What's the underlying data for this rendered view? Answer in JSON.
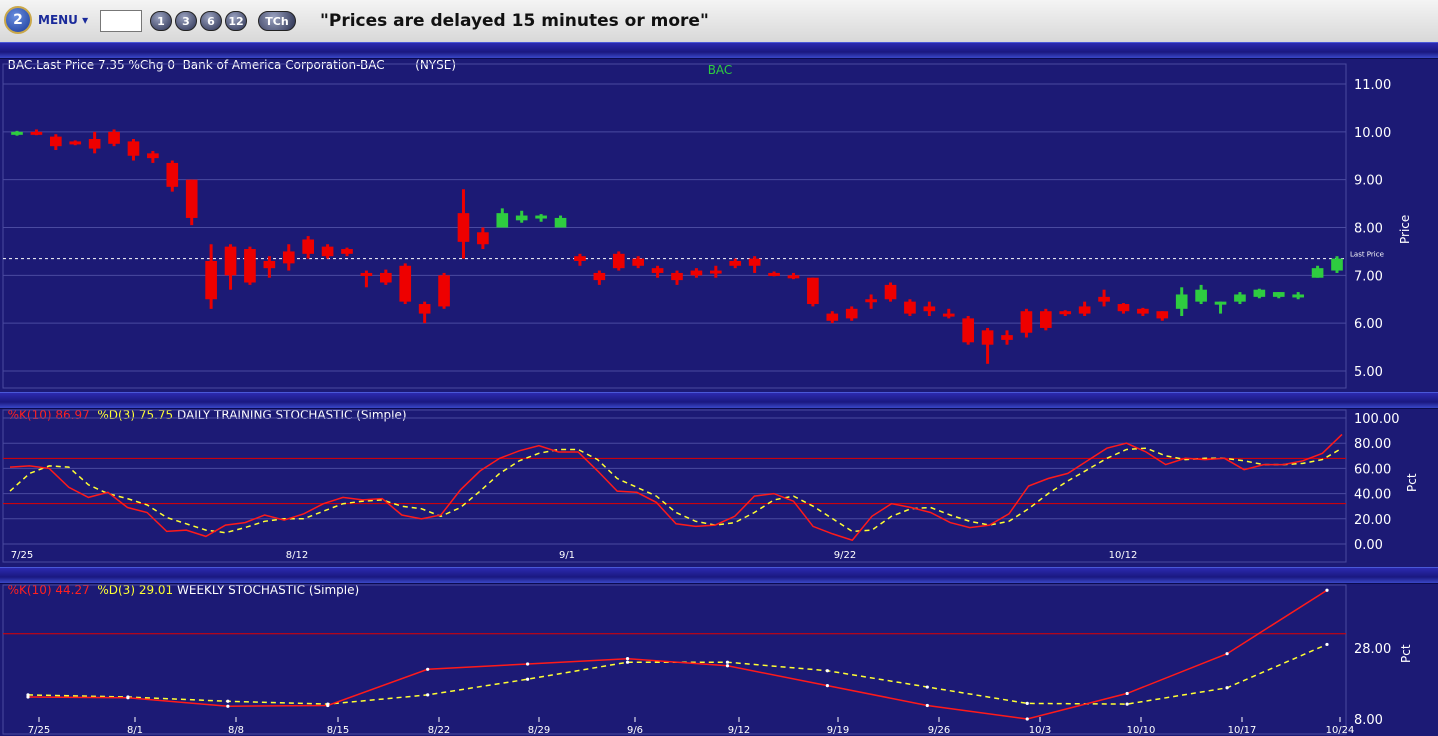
{
  "toolbar": {
    "logo": "2",
    "menu_label": "MENU ▾",
    "period_buttons": [
      "1",
      "3",
      "6",
      "12"
    ],
    "tch_label": "TCh",
    "delay_notice": "\"Prices are delayed 15 minutes or more\""
  },
  "quote_header": {
    "text": "BAC.Last Price 7.35 %Chg 0  Bank of America Corporation-BAC        (NYSE)"
  },
  "colors": {
    "background": "#1c1a75",
    "up_candle": "#2ecc40",
    "down_candle": "#ee0000",
    "k_line": "#ff1a1a",
    "d_line": "#ffff33",
    "grid": "#4a4aa0",
    "axis_text": "#ffffff"
  },
  "chart_data": [
    {
      "type": "candlestick",
      "title": "BAC",
      "ylabel": "Price",
      "ylim": [
        5.0,
        11.0
      ],
      "yticks": [
        "11.00",
        "10.00",
        "9.00",
        "8.00",
        "7.00",
        "6.00",
        "5.00"
      ],
      "last_price": 7.35,
      "last_price_label": "Last Price",
      "candles": [
        {
          "o": 9.95,
          "h": 10.02,
          "l": 9.92,
          "c": 10.0
        },
        {
          "o": 10.0,
          "h": 10.05,
          "l": 9.93,
          "c": 9.97
        },
        {
          "o": 9.9,
          "h": 9.95,
          "l": 9.62,
          "c": 9.7
        },
        {
          "o": 9.8,
          "h": 9.82,
          "l": 9.72,
          "c": 9.74
        },
        {
          "o": 9.85,
          "h": 10.0,
          "l": 9.55,
          "c": 9.65
        },
        {
          "o": 10.0,
          "h": 10.05,
          "l": 9.7,
          "c": 9.75
        },
        {
          "o": 9.8,
          "h": 9.85,
          "l": 9.4,
          "c": 9.5
        },
        {
          "o": 9.55,
          "h": 9.6,
          "l": 9.35,
          "c": 9.45
        },
        {
          "o": 9.35,
          "h": 9.4,
          "l": 8.75,
          "c": 8.85
        },
        {
          "o": 9.0,
          "h": 9.0,
          "l": 8.05,
          "c": 8.2
        },
        {
          "o": 7.3,
          "h": 7.65,
          "l": 6.3,
          "c": 6.5
        },
        {
          "o": 7.6,
          "h": 7.65,
          "l": 6.7,
          "c": 7.0
        },
        {
          "o": 7.55,
          "h": 7.6,
          "l": 6.8,
          "c": 6.85
        },
        {
          "o": 7.3,
          "h": 7.4,
          "l": 6.95,
          "c": 7.15
        },
        {
          "o": 7.5,
          "h": 7.65,
          "l": 7.1,
          "c": 7.25
        },
        {
          "o": 7.75,
          "h": 7.82,
          "l": 7.35,
          "c": 7.45
        },
        {
          "o": 7.6,
          "h": 7.65,
          "l": 7.35,
          "c": 7.4
        },
        {
          "o": 7.55,
          "h": 7.58,
          "l": 7.4,
          "c": 7.45
        },
        {
          "o": 7.05,
          "h": 7.1,
          "l": 6.75,
          "c": 7.0
        },
        {
          "o": 7.05,
          "h": 7.12,
          "l": 6.8,
          "c": 6.85
        },
        {
          "o": 7.2,
          "h": 7.25,
          "l": 6.4,
          "c": 6.45
        },
        {
          "o": 6.4,
          "h": 6.45,
          "l": 6.0,
          "c": 6.2
        },
        {
          "o": 7.0,
          "h": 7.05,
          "l": 6.3,
          "c": 6.35
        },
        {
          "o": 8.3,
          "h": 8.8,
          "l": 7.35,
          "c": 7.7
        },
        {
          "o": 7.9,
          "h": 8.0,
          "l": 7.55,
          "c": 7.65
        },
        {
          "o": 8.0,
          "h": 8.4,
          "l": 8.0,
          "c": 8.3
        },
        {
          "o": 8.15,
          "h": 8.35,
          "l": 8.1,
          "c": 8.25
        },
        {
          "o": 8.2,
          "h": 8.28,
          "l": 8.12,
          "c": 8.25
        },
        {
          "o": 8.0,
          "h": 8.25,
          "l": 8.0,
          "c": 8.2
        },
        {
          "o": 7.4,
          "h": 7.45,
          "l": 7.2,
          "c": 7.3
        },
        {
          "o": 7.05,
          "h": 7.1,
          "l": 6.8,
          "c": 6.9
        },
        {
          "o": 7.45,
          "h": 7.5,
          "l": 7.1,
          "c": 7.15
        },
        {
          "o": 7.35,
          "h": 7.4,
          "l": 7.15,
          "c": 7.2
        },
        {
          "o": 7.15,
          "h": 7.2,
          "l": 6.95,
          "c": 7.05
        },
        {
          "o": 7.05,
          "h": 7.1,
          "l": 6.8,
          "c": 6.9
        },
        {
          "o": 7.1,
          "h": 7.15,
          "l": 6.95,
          "c": 7.0
        },
        {
          "o": 7.1,
          "h": 7.2,
          "l": 6.95,
          "c": 7.05
        },
        {
          "o": 7.3,
          "h": 7.35,
          "l": 7.15,
          "c": 7.2
        },
        {
          "o": 7.35,
          "h": 7.4,
          "l": 7.05,
          "c": 7.2
        },
        {
          "o": 7.05,
          "h": 7.08,
          "l": 6.98,
          "c": 7.0
        },
        {
          "o": 7.0,
          "h": 7.05,
          "l": 6.92,
          "c": 6.95
        },
        {
          "o": 6.95,
          "h": 6.95,
          "l": 6.35,
          "c": 6.4
        },
        {
          "o": 6.2,
          "h": 6.25,
          "l": 6.0,
          "c": 6.05
        },
        {
          "o": 6.3,
          "h": 6.35,
          "l": 6.05,
          "c": 6.1
        },
        {
          "o": 6.5,
          "h": 6.6,
          "l": 6.3,
          "c": 6.45
        },
        {
          "o": 6.8,
          "h": 6.85,
          "l": 6.45,
          "c": 6.5
        },
        {
          "o": 6.45,
          "h": 6.5,
          "l": 6.15,
          "c": 6.2
        },
        {
          "o": 6.35,
          "h": 6.45,
          "l": 6.15,
          "c": 6.25
        },
        {
          "o": 6.2,
          "h": 6.3,
          "l": 6.1,
          "c": 6.15
        },
        {
          "o": 6.1,
          "h": 6.15,
          "l": 5.55,
          "c": 5.6
        },
        {
          "o": 5.85,
          "h": 5.9,
          "l": 5.15,
          "c": 5.55
        },
        {
          "o": 5.75,
          "h": 5.85,
          "l": 5.55,
          "c": 5.65
        },
        {
          "o": 6.25,
          "h": 6.3,
          "l": 5.7,
          "c": 5.8
        },
        {
          "o": 6.25,
          "h": 6.3,
          "l": 5.85,
          "c": 5.9
        },
        {
          "o": 6.25,
          "h": 6.27,
          "l": 6.15,
          "c": 6.2
        },
        {
          "o": 6.35,
          "h": 6.45,
          "l": 6.15,
          "c": 6.2
        },
        {
          "o": 6.55,
          "h": 6.7,
          "l": 6.35,
          "c": 6.45
        },
        {
          "o": 6.4,
          "h": 6.42,
          "l": 6.2,
          "c": 6.25
        },
        {
          "o": 6.3,
          "h": 6.32,
          "l": 6.15,
          "c": 6.2
        },
        {
          "o": 6.25,
          "h": 6.25,
          "l": 6.05,
          "c": 6.1
        },
        {
          "o": 6.3,
          "h": 6.75,
          "l": 6.15,
          "c": 6.6
        },
        {
          "o": 6.45,
          "h": 6.8,
          "l": 6.4,
          "c": 6.7
        },
        {
          "o": 6.4,
          "h": 6.45,
          "l": 6.2,
          "c": 6.45
        },
        {
          "o": 6.45,
          "h": 6.65,
          "l": 6.4,
          "c": 6.6
        },
        {
          "o": 6.55,
          "h": 6.72,
          "l": 6.52,
          "c": 6.7
        },
        {
          "o": 6.55,
          "h": 6.65,
          "l": 6.52,
          "c": 6.65
        },
        {
          "o": 6.55,
          "h": 6.65,
          "l": 6.5,
          "c": 6.6
        },
        {
          "o": 6.95,
          "h": 7.2,
          "l": 6.95,
          "c": 7.15
        },
        {
          "o": 7.1,
          "h": 7.4,
          "l": 7.05,
          "c": 7.35
        }
      ]
    },
    {
      "type": "line",
      "title": "DAILY TRAINING STOCHASTIC (Simple)",
      "ylabel": "Pct",
      "ylim": [
        0,
        100
      ],
      "yticks": [
        "100.00",
        "80.00",
        "60.00",
        "40.00",
        "20.00",
        "0.00"
      ],
      "reference_lines": [
        68,
        32
      ],
      "x_labels": [
        "7/25",
        "8/12",
        "9/1",
        "9/22",
        "10/12"
      ],
      "k_label": "%K(10) 86.97",
      "d_label": "%D(3) 75.75",
      "k_values": [
        61,
        62,
        60,
        45,
        37,
        41,
        29,
        25,
        10,
        11,
        6,
        15,
        17,
        23,
        19,
        24,
        32,
        37,
        35,
        36,
        23,
        20,
        23,
        43,
        58,
        68,
        74,
        78,
        73,
        73,
        58,
        42,
        41,
        33,
        16,
        14,
        15,
        22,
        38,
        40,
        34,
        14,
        8,
        3,
        22,
        32,
        29,
        25,
        17,
        13,
        15,
        24,
        46,
        52,
        56,
        66,
        76,
        80,
        73,
        63,
        68,
        67,
        68,
        59,
        63,
        63,
        66,
        72,
        87
      ],
      "d_values": [
        42,
        56,
        62,
        61,
        47,
        40,
        36,
        31,
        21,
        16,
        11,
        9,
        13,
        18,
        20,
        20,
        26,
        32,
        34,
        35,
        30,
        28,
        22,
        29,
        42,
        56,
        66,
        72,
        75,
        75,
        67,
        52,
        45,
        38,
        25,
        18,
        15,
        17,
        25,
        35,
        38,
        30,
        20,
        10,
        11,
        22,
        28,
        29,
        23,
        18,
        15,
        18,
        28,
        40,
        50,
        59,
        68,
        75,
        76,
        70,
        67,
        68,
        68,
        66,
        63,
        63,
        64,
        67,
        76
      ]
    },
    {
      "type": "line",
      "title": "WEEKLY STOCHASTIC (Simple)",
      "ylabel": "Pct",
      "yticks": [
        "28.00",
        "8.00"
      ],
      "reference_lines": [
        32
      ],
      "x_labels": [
        "7/25",
        "8/1",
        "8/8",
        "8/15",
        "8/22",
        "8/29",
        "9/6",
        "9/12",
        "9/19",
        "9/26",
        "10/3",
        "10/10",
        "10/17",
        "10/24"
      ],
      "k_label": "%K(10) 44.27",
      "d_label": "%D(3) 29.01",
      "k_values": [
        14.2,
        14.0,
        11.6,
        11.8,
        22.0,
        23.5,
        25.0,
        23.0,
        17.4,
        11.8,
        8.0,
        15.2,
        26.4,
        44.27
      ],
      "d_values": [
        14.8,
        14.2,
        13.0,
        12.2,
        14.8,
        19.2,
        24.0,
        24.0,
        21.6,
        17.0,
        12.4,
        12.2,
        16.8,
        29.01
      ]
    }
  ]
}
